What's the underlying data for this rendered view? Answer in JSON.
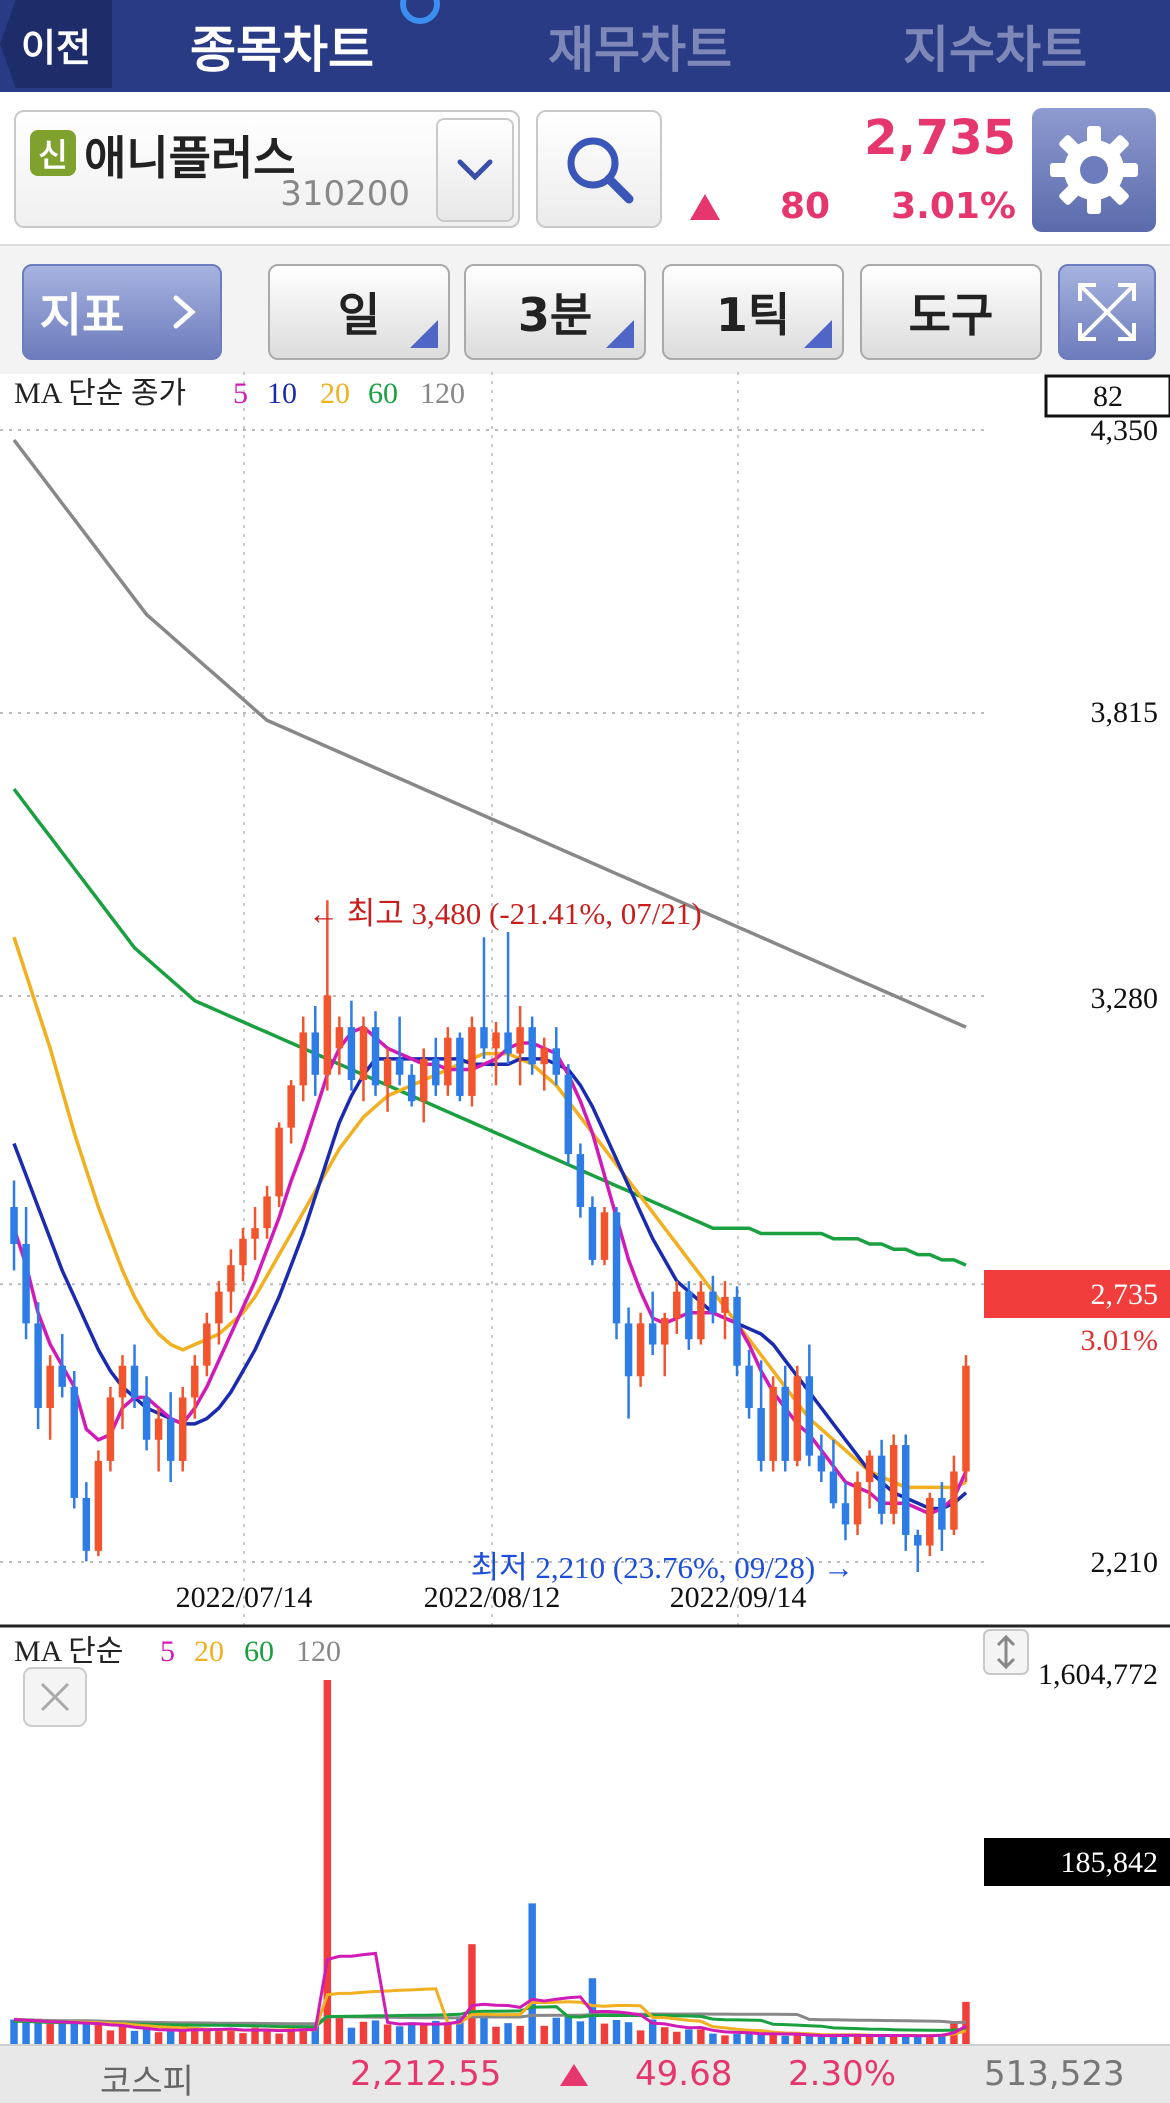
{
  "nav": {
    "back_label": "이전",
    "tabs": [
      {
        "label": "종목차트",
        "active": true
      },
      {
        "label": "재무차트",
        "active": false
      },
      {
        "label": "지수차트",
        "active": false
      }
    ]
  },
  "stock": {
    "credit_badge": "신",
    "name": "애니플러스",
    "code": "310200",
    "price": "2,735",
    "change": "80",
    "change_pct": "3.01%",
    "up_color": "#e5366d"
  },
  "toolbar": {
    "indicator_label": "지표",
    "period_label": "일",
    "minute_label": "3분",
    "tick_label": "1틱",
    "tools_label": "도구"
  },
  "chart_data": [
    {
      "type": "candlestick",
      "legend_title": "MA 단순 종가",
      "ma_periods": [
        "5",
        "10",
        "20",
        "60",
        "120"
      ],
      "ma_colors": [
        "#d11bb7",
        "#1a2bb0",
        "#f0b020",
        "#1aa040",
        "#888888"
      ],
      "y_ticks": [
        "4,350",
        "3,815",
        "3,280",
        "2,210"
      ],
      "ylim": [
        2210,
        4350
      ],
      "x_ticks": [
        "2022/07/14",
        "2022/08/12",
        "2022/09/14"
      ],
      "counter": "82",
      "last_price_label": "2,735",
      "last_pct_label": "3.01%",
      "high_annotation": "← 최고 3,480 (-21.41%, 07/21)",
      "low_annotation": "최저 2,210 (23.76%, 09/28) →",
      "candles": [
        [
          2900,
          2950,
          2780,
          2830
        ],
        [
          2830,
          2900,
          2650,
          2680
        ],
        [
          2680,
          2720,
          2480,
          2520
        ],
        [
          2520,
          2620,
          2460,
          2600
        ],
        [
          2600,
          2660,
          2540,
          2560
        ],
        [
          2560,
          2590,
          2330,
          2350
        ],
        [
          2350,
          2380,
          2230,
          2250
        ],
        [
          2250,
          2440,
          2240,
          2420
        ],
        [
          2420,
          2560,
          2400,
          2540
        ],
        [
          2540,
          2620,
          2480,
          2600
        ],
        [
          2600,
          2640,
          2520,
          2540
        ],
        [
          2540,
          2580,
          2440,
          2460
        ],
        [
          2460,
          2520,
          2400,
          2500
        ],
        [
          2500,
          2550,
          2380,
          2420
        ],
        [
          2420,
          2560,
          2400,
          2540
        ],
        [
          2540,
          2620,
          2500,
          2600
        ],
        [
          2600,
          2700,
          2580,
          2680
        ],
        [
          2680,
          2760,
          2640,
          2740
        ],
        [
          2740,
          2820,
          2700,
          2790
        ],
        [
          2790,
          2860,
          2760,
          2840
        ],
        [
          2840,
          2900,
          2800,
          2860
        ],
        [
          2860,
          2940,
          2840,
          2920
        ],
        [
          2920,
          3060,
          2900,
          3050
        ],
        [
          3050,
          3140,
          3020,
          3130
        ],
        [
          3130,
          3260,
          3100,
          3230
        ],
        [
          3230,
          3280,
          3110,
          3150
        ],
        [
          3150,
          3480,
          3120,
          3300
        ],
        [
          3200,
          3260,
          3150,
          3240
        ],
        [
          3240,
          3290,
          3120,
          3140
        ],
        [
          3140,
          3260,
          3100,
          3240
        ],
        [
          3240,
          3270,
          3110,
          3130
        ],
        [
          3130,
          3200,
          3080,
          3180
        ],
        [
          3180,
          3260,
          3130,
          3150
        ],
        [
          3150,
          3170,
          3090,
          3100
        ],
        [
          3100,
          3200,
          3060,
          3180
        ],
        [
          3180,
          3220,
          3110,
          3130
        ],
        [
          3130,
          3240,
          3110,
          3220
        ],
        [
          3220,
          3230,
          3100,
          3110
        ],
        [
          3110,
          3260,
          3090,
          3240
        ],
        [
          3240,
          3410,
          3180,
          3200
        ],
        [
          3200,
          3250,
          3130,
          3230
        ],
        [
          3230,
          3420,
          3170,
          3190
        ],
        [
          3190,
          3280,
          3130,
          3240
        ],
        [
          3240,
          3260,
          3150,
          3170
        ],
        [
          3170,
          3220,
          3120,
          3200
        ],
        [
          3200,
          3240,
          3130,
          3150
        ],
        [
          3150,
          3170,
          2980,
          3000
        ],
        [
          3000,
          3020,
          2880,
          2900
        ],
        [
          2900,
          2920,
          2790,
          2800
        ],
        [
          2800,
          2900,
          2790,
          2890
        ],
        [
          2890,
          2900,
          2650,
          2680
        ],
        [
          2680,
          2710,
          2500,
          2580
        ],
        [
          2580,
          2700,
          2560,
          2680
        ],
        [
          2680,
          2740,
          2620,
          2640
        ],
        [
          2640,
          2700,
          2580,
          2690
        ],
        [
          2690,
          2760,
          2660,
          2740
        ],
        [
          2740,
          2760,
          2630,
          2650
        ],
        [
          2650,
          2760,
          2640,
          2740
        ],
        [
          2740,
          2770,
          2680,
          2700
        ],
        [
          2700,
          2760,
          2650,
          2730
        ],
        [
          2730,
          2750,
          2580,
          2600
        ],
        [
          2600,
          2630,
          2500,
          2520
        ],
        [
          2520,
          2610,
          2400,
          2420
        ],
        [
          2420,
          2580,
          2400,
          2560
        ],
        [
          2560,
          2600,
          2400,
          2420
        ],
        [
          2420,
          2600,
          2410,
          2580
        ],
        [
          2580,
          2640,
          2410,
          2430
        ],
        [
          2430,
          2470,
          2380,
          2400
        ],
        [
          2400,
          2460,
          2330,
          2340
        ],
        [
          2340,
          2380,
          2270,
          2300
        ],
        [
          2300,
          2400,
          2280,
          2380
        ],
        [
          2380,
          2440,
          2330,
          2430
        ],
        [
          2430,
          2460,
          2300,
          2320
        ],
        [
          2320,
          2470,
          2300,
          2450
        ],
        [
          2450,
          2470,
          2250,
          2280
        ],
        [
          2280,
          2290,
          2210,
          2260
        ],
        [
          2260,
          2360,
          2240,
          2350
        ],
        [
          2350,
          2380,
          2250,
          2290
        ],
        [
          2290,
          2430,
          2280,
          2400
        ],
        [
          2400,
          2620,
          2380,
          2600
        ]
      ],
      "ma5": [
        2860,
        2790,
        2700,
        2640,
        2600,
        2560,
        2480,
        2460,
        2470,
        2520,
        2540,
        2540,
        2520,
        2500,
        2490,
        2520,
        2560,
        2610,
        2660,
        2710,
        2760,
        2820,
        2880,
        2950,
        3010,
        3080,
        3150,
        3200,
        3230,
        3240,
        3220,
        3200,
        3190,
        3180,
        3170,
        3170,
        3160,
        3160,
        3160,
        3170,
        3180,
        3200,
        3210,
        3210,
        3200,
        3190,
        3150,
        3100,
        3040,
        2960,
        2880,
        2800,
        2740,
        2690,
        2680,
        2690,
        2700,
        2700,
        2700,
        2690,
        2680,
        2640,
        2590,
        2550,
        2520,
        2490,
        2470,
        2440,
        2410,
        2380,
        2370,
        2360,
        2340,
        2340,
        2340,
        2330,
        2320,
        2330,
        2350,
        2400
      ],
      "ma10": [
        3020,
        2960,
        2900,
        2840,
        2780,
        2730,
        2680,
        2630,
        2590,
        2560,
        2540,
        2520,
        2510,
        2500,
        2490,
        2490,
        2500,
        2520,
        2550,
        2590,
        2630,
        2680,
        2730,
        2790,
        2850,
        2920,
        2990,
        3060,
        3110,
        3150,
        3180,
        3180,
        3180,
        3180,
        3180,
        3180,
        3180,
        3180,
        3170,
        3170,
        3170,
        3170,
        3180,
        3180,
        3180,
        3170,
        3160,
        3130,
        3090,
        3040,
        2990,
        2940,
        2890,
        2840,
        2800,
        2760,
        2740,
        2720,
        2700,
        2690,
        2680,
        2670,
        2660,
        2640,
        2610,
        2580,
        2550,
        2520,
        2490,
        2460,
        2430,
        2400,
        2380,
        2360,
        2350,
        2340,
        2330,
        2330,
        2340,
        2360
      ],
      "ma20": [
        3410,
        3340,
        3270,
        3200,
        3120,
        3040,
        2970,
        2900,
        2840,
        2780,
        2730,
        2690,
        2660,
        2640,
        2630,
        2640,
        2650,
        2660,
        2680,
        2700,
        2730,
        2770,
        2810,
        2850,
        2890,
        2930,
        2970,
        3010,
        3040,
        3070,
        3090,
        3110,
        3120,
        3130,
        3140,
        3150,
        3160,
        3170,
        3180,
        3190,
        3190,
        3190,
        3180,
        3170,
        3150,
        3130,
        3100,
        3070,
        3040,
        3010,
        2980,
        2950,
        2920,
        2890,
        2860,
        2830,
        2800,
        2770,
        2740,
        2710,
        2680,
        2650,
        2620,
        2590,
        2560,
        2530,
        2500,
        2480,
        2460,
        2440,
        2420,
        2400,
        2390,
        2380,
        2370,
        2370,
        2370,
        2370,
        2370,
        2380
      ],
      "ma60": [
        3690,
        3660,
        3630,
        3600,
        3570,
        3540,
        3510,
        3480,
        3450,
        3420,
        3390,
        3370,
        3350,
        3330,
        3310,
        3290,
        3280,
        3270,
        3260,
        3250,
        3240,
        3230,
        3220,
        3210,
        3200,
        3190,
        3180,
        3170,
        3160,
        3150,
        3140,
        3130,
        3120,
        3110,
        3100,
        3090,
        3080,
        3070,
        3060,
        3050,
        3040,
        3030,
        3020,
        3010,
        3000,
        2990,
        2980,
        2970,
        2960,
        2950,
        2940,
        2930,
        2920,
        2910,
        2900,
        2890,
        2880,
        2870,
        2860,
        2860,
        2860,
        2860,
        2850,
        2850,
        2850,
        2850,
        2850,
        2850,
        2840,
        2840,
        2840,
        2830,
        2830,
        2820,
        2820,
        2810,
        2810,
        2800,
        2800,
        2790
      ],
      "ma120": [
        4350,
        4320,
        4290,
        4260,
        4230,
        4200,
        4170,
        4140,
        4110,
        4080,
        4050,
        4020,
        4000,
        3980,
        3960,
        3940,
        3920,
        3900,
        3880,
        3860,
        3840,
        3820,
        3810,
        3800,
        3790,
        3780,
        3770,
        3760,
        3750,
        3740,
        3730,
        3720,
        3710,
        3700,
        3690,
        3680,
        3670,
        3660,
        3650,
        3640,
        3630,
        3620,
        3610,
        3600,
        3590,
        3580,
        3570,
        3560,
        3550,
        3540,
        3530,
        3520,
        3510,
        3500,
        3490,
        3480,
        3470,
        3460,
        3450,
        3440,
        3430,
        3420,
        3410,
        3400,
        3390,
        3380,
        3370,
        3360,
        3350,
        3340,
        3330,
        3320,
        3310,
        3300,
        3290,
        3280,
        3270,
        3260,
        3250,
        3240
      ]
    },
    {
      "type": "bar",
      "legend_title": "MA 단순",
      "ma_periods": [
        "5",
        "20",
        "60",
        "120"
      ],
      "ma_colors": [
        "#d11bb7",
        "#f0b020",
        "#1aa040",
        "#888888"
      ],
      "y_ticks": [
        "1,604,772"
      ],
      "ylim": [
        0,
        1604772
      ],
      "last_volume_label": "185,842",
      "volumes": [
        108000,
        102000,
        95000,
        88000,
        92000,
        96000,
        90000,
        84000,
        60000,
        78000,
        58000,
        64000,
        52000,
        56000,
        70000,
        74000,
        62000,
        58000,
        66000,
        48000,
        72000,
        64000,
        46000,
        70000,
        62000,
        78000,
        1604772,
        118000,
        72000,
        98000,
        104000,
        86000,
        78000,
        84000,
        88000,
        102000,
        96000,
        122000,
        440000,
        118000,
        76000,
        92000,
        80000,
        620000,
        80000,
        116000,
        122000,
        100000,
        290000,
        90000,
        106000,
        96000,
        60000,
        108000,
        74000,
        54000,
        64000,
        64000,
        46000,
        38000,
        44000,
        58000,
        42000,
        40000,
        36000,
        42000,
        38000,
        32000,
        38000,
        40000,
        42000,
        36000,
        32000,
        38000,
        40000,
        38000,
        36000,
        42000,
        90000,
        185842
      ]
    }
  ],
  "footer": {
    "index_name": "코스피",
    "index_value": "2,212.55",
    "index_change": "49.68",
    "index_pct": "2.30%",
    "index_volume": "513,523"
  }
}
